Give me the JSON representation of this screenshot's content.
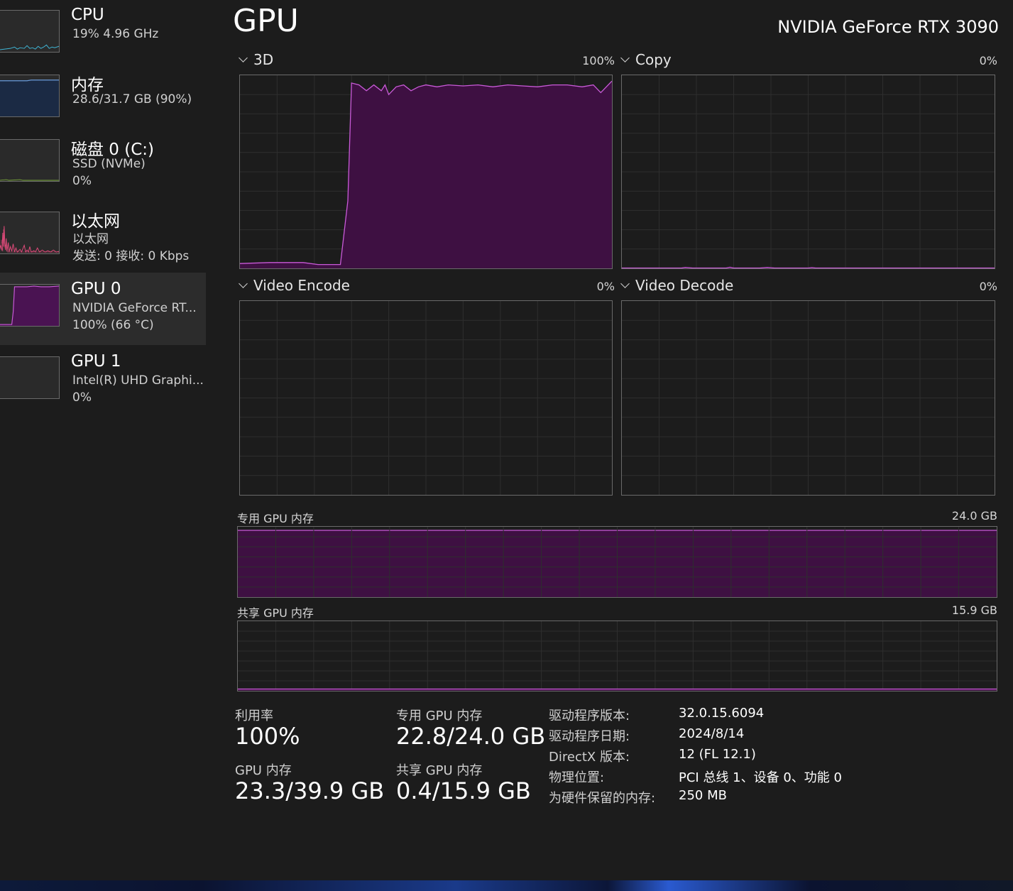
{
  "sidebar": {
    "items": [
      {
        "title": "CPU",
        "line1": "19%  4.96 GHz",
        "line2": ""
      },
      {
        "title": "内存",
        "line1": "28.6/31.7 GB (90%)",
        "line2": ""
      },
      {
        "title": "磁盘 0 (C:)",
        "line1": "SSD (NVMe)",
        "line2": "0%"
      },
      {
        "title": "以太网",
        "line1": "以太网",
        "line2": "发送: 0 接收: 0 Kbps"
      },
      {
        "title": "GPU 0",
        "line1": "NVIDIA GeForce RT...",
        "line2": "100%  (66 °C)"
      },
      {
        "title": "GPU 1",
        "line1": "Intel(R) UHD Graphi...",
        "line2": "0%"
      }
    ]
  },
  "header": {
    "title": "GPU",
    "device": "NVIDIA GeForce RTX 3090"
  },
  "engines": [
    {
      "name": "3D",
      "pct": "100%",
      "level": 0.96
    },
    {
      "name": "Copy",
      "pct": "0%",
      "level": 0
    },
    {
      "name": "Video Encode",
      "pct": "0%",
      "level": 0
    },
    {
      "name": "Video Decode",
      "pct": "0%",
      "level": 0
    }
  ],
  "memory_graphs": {
    "dedicated": {
      "label": "专用 GPU 内存",
      "max": "24.0 GB",
      "fraction": 0.95
    },
    "shared": {
      "label": "共享 GPU 内存",
      "max": "15.9 GB",
      "fraction": 0.025
    }
  },
  "stats": {
    "utilization": {
      "label": "利用率",
      "value": "100%"
    },
    "dedicated_mem": {
      "label": "专用 GPU 内存",
      "value": "22.8/24.0 GB"
    },
    "gpu_mem": {
      "label": "GPU 内存",
      "value": "23.3/39.9 GB"
    },
    "shared_mem": {
      "label": "共享 GPU 内存",
      "value": "0.4/15.9 GB"
    }
  },
  "properties": [
    {
      "key": "驱动程序版本:",
      "value": "32.0.15.6094"
    },
    {
      "key": "驱动程序日期:",
      "value": "2024/8/14"
    },
    {
      "key": "DirectX 版本:",
      "value": "12 (FL 12.1)"
    },
    {
      "key": "物理位置:",
      "value": "PCI 总线 1、设备 0、功能 0"
    },
    {
      "key": "为硬件保留的内存:",
      "value": "250 MB"
    }
  ],
  "colors": {
    "gpu_line": "#c95ad8",
    "gpu_fill": "#3e1042",
    "cpu_line": "#3fb6d6",
    "mem_line": "#6a9ad8",
    "net_line": "#e04a7a",
    "disk_line": "#7aa83a",
    "grid": "#2e2e2e"
  }
}
